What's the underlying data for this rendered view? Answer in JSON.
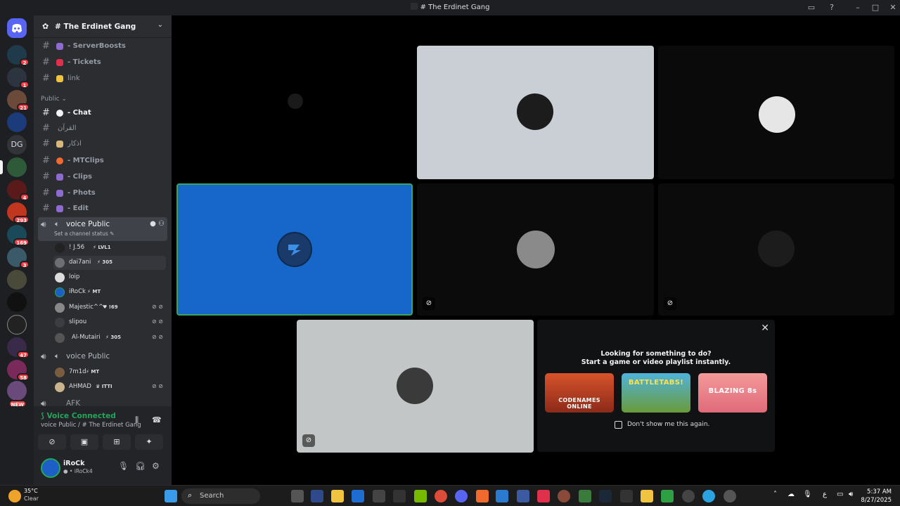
{
  "window": {
    "title": "# The Erdinet Gang"
  },
  "rail": {
    "servers": [
      {
        "badge": "2"
      },
      {
        "badge": "1"
      },
      {
        "badge": "21"
      },
      {
        "badge": ""
      },
      {
        "label": "DG",
        "badge": ""
      },
      {
        "badge": ""
      },
      {
        "badge": "4"
      },
      {
        "badge": "293"
      },
      {
        "badge": "169"
      },
      {
        "badge": "3"
      },
      {
        "badge": ""
      },
      {
        "badge": ""
      },
      {
        "badge": ""
      },
      {
        "badge": "47"
      },
      {
        "badge": "58"
      },
      {
        "badge": "NEW"
      }
    ]
  },
  "guild": {
    "name": "The Erdinet Gang"
  },
  "channels_top": [
    {
      "label": "- ServerBoosts",
      "color": "#8e6ad1"
    },
    {
      "label": "- Tickets",
      "color": "#e0304c"
    },
    {
      "label": "link",
      "color": "#f0c341"
    }
  ],
  "category_public": "Public",
  "channels_public": [
    {
      "label": "- Chat",
      "color": "#f2f3f5",
      "active": true
    },
    {
      "label": "القرآن",
      "plain": true
    },
    {
      "label": "اذكار",
      "plain": true
    },
    {
      "label": "- MTClips",
      "color": "#f06a2e"
    },
    {
      "label": "- Clips",
      "color": "#8e6ad1"
    },
    {
      "label": "- Phots",
      "color": "#8e6ad1"
    },
    {
      "label": "- Edit",
      "color": "#8e6ad1"
    }
  ],
  "voice1": {
    "name": "voice Public",
    "status": "Set a channel status"
  },
  "members1": [
    {
      "name": "! J.56",
      "tag": "LVL1",
      "av": "#222"
    },
    {
      "name": "dai7ani",
      "tag": "305",
      "av": "#6d6f74"
    },
    {
      "name": "loip",
      "tag": "",
      "av": "#dcdcdc"
    },
    {
      "name": "iRoCk",
      "tag": "MT",
      "av": "#1d5fc7"
    },
    {
      "name": "Majestic^^",
      "tag": "!69",
      "av": "#888"
    },
    {
      "name": "slipou",
      "tag": "",
      "av": "#3b3d42"
    },
    {
      "name": "Al-Mutairi",
      "tag": "305",
      "av": "#555"
    }
  ],
  "voice2": {
    "name": "voice Public"
  },
  "members2": [
    {
      "name": "7m1d",
      "tag": "MT",
      "av": "#7a5c3e"
    },
    {
      "name": "AHMAD",
      "tag": "ITTI",
      "av": "#c9b48d"
    }
  ],
  "next_channel": "AFK",
  "voice_panel": {
    "title": "Voice Connected",
    "sub": "voice Public / # The Erdinet Gang"
  },
  "user": {
    "name": "iRoCk",
    "sub": "iRoCk4"
  },
  "popup": {
    "line1": "Looking for something to do?",
    "line2": "Start a game or video playlist instantly.",
    "games": [
      "CODENAMES ONLINE",
      "BATTLETABS!",
      "BLAZING 8s"
    ],
    "checkbox": "Don't show me this again."
  },
  "taskbar": {
    "weather_temp": "35°C",
    "weather_desc": "Clear",
    "search": "Search",
    "time": "5:37 AM",
    "date": "8/27/2025"
  }
}
